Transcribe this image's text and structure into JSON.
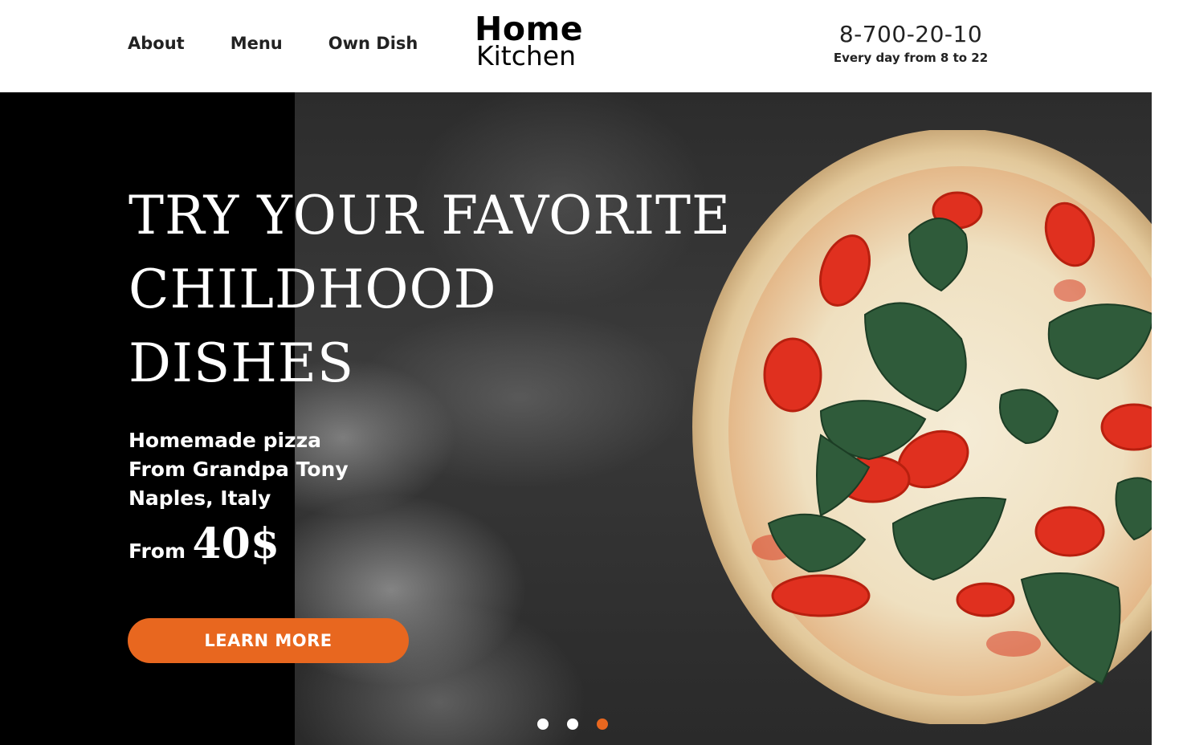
{
  "header": {
    "nav": [
      "About",
      "Menu",
      "Own Dish"
    ],
    "logo_line1": "Home",
    "logo_line2": "Kitchen",
    "phone": "8-700-20-10",
    "hours": "Every day from 8 to 22"
  },
  "hero": {
    "headline": [
      "TRY YOUR FAVORITE",
      "CHILDHOOD",
      "DISHES"
    ],
    "subtitle": [
      "Homemade pizza",
      "From Grandpa Tony",
      "Naples, Italy"
    ],
    "price_prefix": "From",
    "price": "40$",
    "cta_label": "LEARN MORE",
    "slides_total": 3,
    "active_slide": 3
  },
  "colors": {
    "accent": "#e8671f",
    "hero_background": "#000000",
    "text_light": "#ffffff",
    "text_dark": "#222222"
  }
}
